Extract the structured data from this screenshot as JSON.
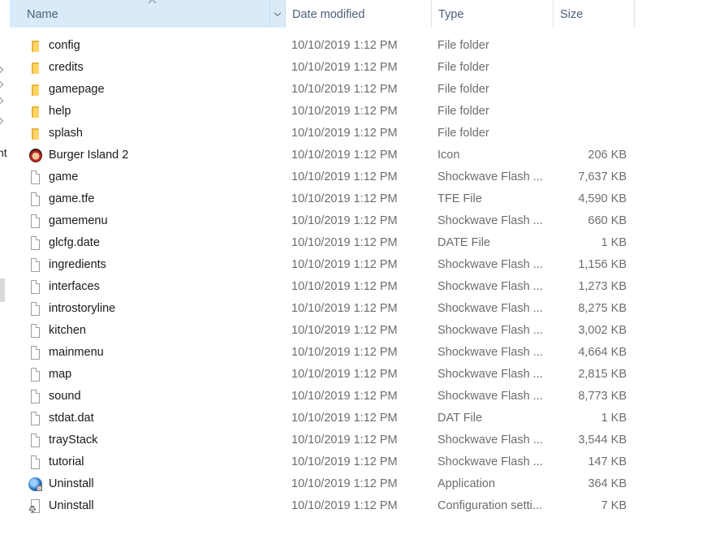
{
  "nav": {
    "fragment": "nt"
  },
  "columns": {
    "name": "Name",
    "date": "Date modified",
    "type": "Type",
    "size": "Size",
    "sorted_by": "Name",
    "sort_direction": "ascending"
  },
  "files": [
    {
      "name": "config",
      "date": "10/10/2019 1:12 PM",
      "type": "File folder",
      "size": "",
      "icon": "folder-icon"
    },
    {
      "name": "credits",
      "date": "10/10/2019 1:12 PM",
      "type": "File folder",
      "size": "",
      "icon": "folder-icon"
    },
    {
      "name": "gamepage",
      "date": "10/10/2019 1:12 PM",
      "type": "File folder",
      "size": "",
      "icon": "folder-icon"
    },
    {
      "name": "help",
      "date": "10/10/2019 1:12 PM",
      "type": "File folder",
      "size": "",
      "icon": "folder-icon"
    },
    {
      "name": "splash",
      "date": "10/10/2019 1:12 PM",
      "type": "File folder",
      "size": "",
      "icon": "folder-icon"
    },
    {
      "name": "Burger Island 2",
      "date": "10/10/2019 1:12 PM",
      "type": "Icon",
      "size": "206 KB",
      "icon": "game-character-icon"
    },
    {
      "name": "game",
      "date": "10/10/2019 1:12 PM",
      "type": "Shockwave Flash ...",
      "size": "7,637 KB",
      "icon": "blank-file-icon"
    },
    {
      "name": "game.tfe",
      "date": "10/10/2019 1:12 PM",
      "type": "TFE File",
      "size": "4,590 KB",
      "icon": "blank-file-icon"
    },
    {
      "name": "gamemenu",
      "date": "10/10/2019 1:12 PM",
      "type": "Shockwave Flash ...",
      "size": "660 KB",
      "icon": "blank-file-icon"
    },
    {
      "name": "glcfg.date",
      "date": "10/10/2019 1:12 PM",
      "type": "DATE File",
      "size": "1 KB",
      "icon": "blank-file-icon"
    },
    {
      "name": "ingredients",
      "date": "10/10/2019 1:12 PM",
      "type": "Shockwave Flash ...",
      "size": "1,156 KB",
      "icon": "blank-file-icon"
    },
    {
      "name": "interfaces",
      "date": "10/10/2019 1:12 PM",
      "type": "Shockwave Flash ...",
      "size": "1,273 KB",
      "icon": "blank-file-icon"
    },
    {
      "name": "introstoryline",
      "date": "10/10/2019 1:12 PM",
      "type": "Shockwave Flash ...",
      "size": "8,275 KB",
      "icon": "blank-file-icon"
    },
    {
      "name": "kitchen",
      "date": "10/10/2019 1:12 PM",
      "type": "Shockwave Flash ...",
      "size": "3,002 KB",
      "icon": "blank-file-icon"
    },
    {
      "name": "mainmenu",
      "date": "10/10/2019 1:12 PM",
      "type": "Shockwave Flash ...",
      "size": "4,664 KB",
      "icon": "blank-file-icon"
    },
    {
      "name": "map",
      "date": "10/10/2019 1:12 PM",
      "type": "Shockwave Flash ...",
      "size": "2,815 KB",
      "icon": "blank-file-icon"
    },
    {
      "name": "sound",
      "date": "10/10/2019 1:12 PM",
      "type": "Shockwave Flash ...",
      "size": "8,773 KB",
      "icon": "blank-file-icon"
    },
    {
      "name": "stdat.dat",
      "date": "10/10/2019 1:12 PM",
      "type": "DAT File",
      "size": "1 KB",
      "icon": "blank-file-icon"
    },
    {
      "name": "trayStack",
      "date": "10/10/2019 1:12 PM",
      "type": "Shockwave Flash ...",
      "size": "3,544 KB",
      "icon": "blank-file-icon"
    },
    {
      "name": "tutorial",
      "date": "10/10/2019 1:12 PM",
      "type": "Shockwave Flash ...",
      "size": "147 KB",
      "icon": "blank-file-icon"
    },
    {
      "name": "Uninstall",
      "date": "10/10/2019 1:12 PM",
      "type": "Application",
      "size": "364 KB",
      "icon": "uninstaller-globe-icon"
    },
    {
      "name": "Uninstall",
      "date": "10/10/2019 1:12 PM",
      "type": "Configuration setti...",
      "size": "7 KB",
      "icon": "config-settings-gear-icon"
    }
  ],
  "colors": {
    "header_selected_bg": "#d9ebf9",
    "header_text": "#4c607a",
    "secondary_text": "#6d6d6d",
    "folder_yellow": "#ffd466"
  }
}
